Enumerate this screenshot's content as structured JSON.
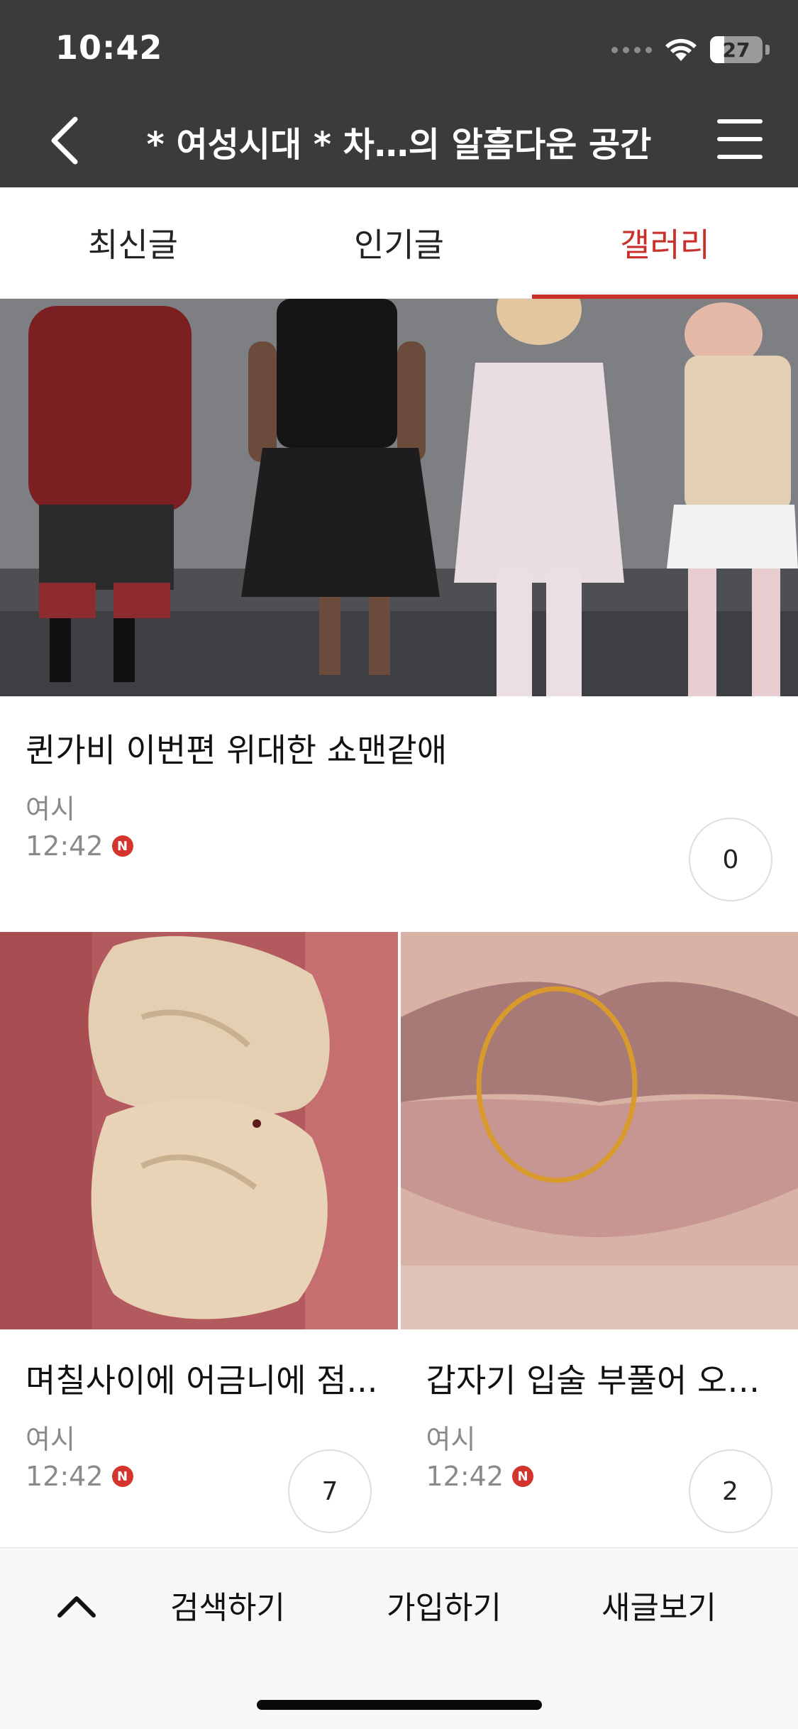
{
  "status_bar": {
    "time": "10:42",
    "battery_level": "27"
  },
  "header": {
    "title": "* 여성시대 *  차…의 알흠다운 공간"
  },
  "tabs": [
    {
      "label": "최신글"
    },
    {
      "label": "인기글"
    },
    {
      "label": "갤러리",
      "active": true
    }
  ],
  "posts": [
    {
      "title": "퀸가비 이번편 위대한 쇼맨같애",
      "author": "여시",
      "time": "12:42",
      "badge": "N",
      "comments": "0"
    },
    {
      "title": "며칠사이에 어금니에 점...",
      "author": "여시",
      "time": "12:42",
      "badge": "N",
      "comments": "7"
    },
    {
      "title": "갑자기 입술 부풀어 오…",
      "author": "여시",
      "time": "12:42",
      "badge": "N",
      "comments": "2"
    }
  ],
  "bottom_bar": {
    "up_icon": "chevron-up-icon",
    "search_label": "검색하기",
    "join_label": "가입하기",
    "new_posts_label": "새글보기"
  },
  "colors": {
    "header_bg": "#3b3b3b",
    "accent": "#c8302c",
    "badge": "#d4342d"
  }
}
